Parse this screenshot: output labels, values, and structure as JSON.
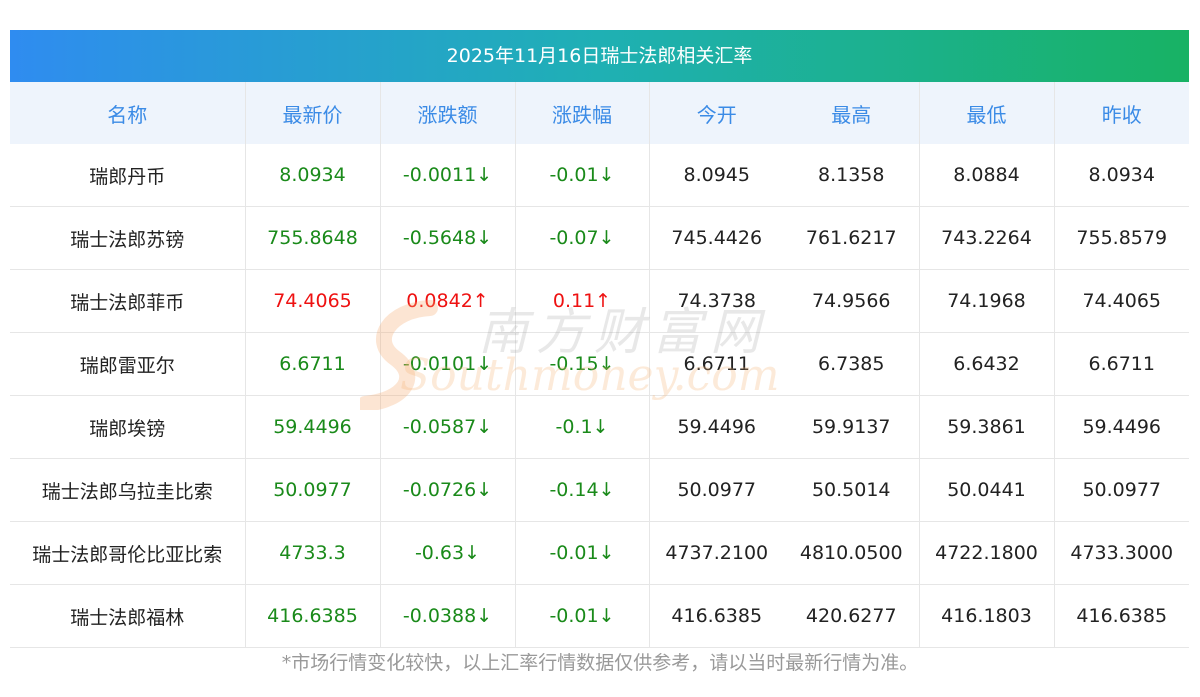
{
  "title": "2025年11月16日瑞士法郎相关汇率",
  "headers": [
    "名称",
    "最新价",
    "涨跌额",
    "涨跌幅",
    "今开",
    "最高",
    "最低",
    "昨收"
  ],
  "rows": [
    {
      "name": "瑞郎丹币",
      "latest": "8.0934",
      "change": "-0.0011↓",
      "pct": "-0.01↓",
      "open": "8.0945",
      "high": "8.1358",
      "low": "8.0884",
      "prev": "8.0934",
      "trend": "down"
    },
    {
      "name": "瑞士法郎苏镑",
      "latest": "755.8648",
      "change": "-0.5648↓",
      "pct": "-0.07↓",
      "open": "745.4426",
      "high": "761.6217",
      "low": "743.2264",
      "prev": "755.8579",
      "trend": "down"
    },
    {
      "name": "瑞士法郎菲币",
      "latest": "74.4065",
      "change": "0.0842↑",
      "pct": "0.11↑",
      "open": "74.3738",
      "high": "74.9566",
      "low": "74.1968",
      "prev": "74.4065",
      "trend": "up"
    },
    {
      "name": "瑞郎雷亚尔",
      "latest": "6.6711",
      "change": "-0.0101↓",
      "pct": "-0.15↓",
      "open": "6.6711",
      "high": "6.7385",
      "low": "6.6432",
      "prev": "6.6711",
      "trend": "down"
    },
    {
      "name": "瑞郎埃镑",
      "latest": "59.4496",
      "change": "-0.0587↓",
      "pct": "-0.1↓",
      "open": "59.4496",
      "high": "59.9137",
      "low": "59.3861",
      "prev": "59.4496",
      "trend": "down"
    },
    {
      "name": "瑞士法郎乌拉圭比索",
      "latest": "50.0977",
      "change": "-0.0726↓",
      "pct": "-0.14↓",
      "open": "50.0977",
      "high": "50.5014",
      "low": "50.0441",
      "prev": "50.0977",
      "trend": "down"
    },
    {
      "name": "瑞士法郎哥伦比亚比索",
      "latest": "4733.3",
      "change": "-0.63↓",
      "pct": "-0.01↓",
      "open": "4737.2100",
      "high": "4810.0500",
      "low": "4722.1800",
      "prev": "4733.3000",
      "trend": "down"
    },
    {
      "name": "瑞士法郎福林",
      "latest": "416.6385",
      "change": "-0.0388↓",
      "pct": "-0.01↓",
      "open": "416.6385",
      "high": "420.6277",
      "low": "416.1803",
      "prev": "416.6385",
      "trend": "down"
    }
  ],
  "footer": "*市场行情变化较快，以上汇率行情数据仅供参考，请以当时最新行情为准。",
  "watermark": {
    "cn": "南方财富网",
    "en": "Southmoney.com"
  },
  "colors": {
    "up": "#ee1111",
    "down": "#1a8a1a",
    "header_text": "#3b8be6",
    "title_gradient_start": "#2f8cf0",
    "title_gradient_end": "#18b264"
  }
}
